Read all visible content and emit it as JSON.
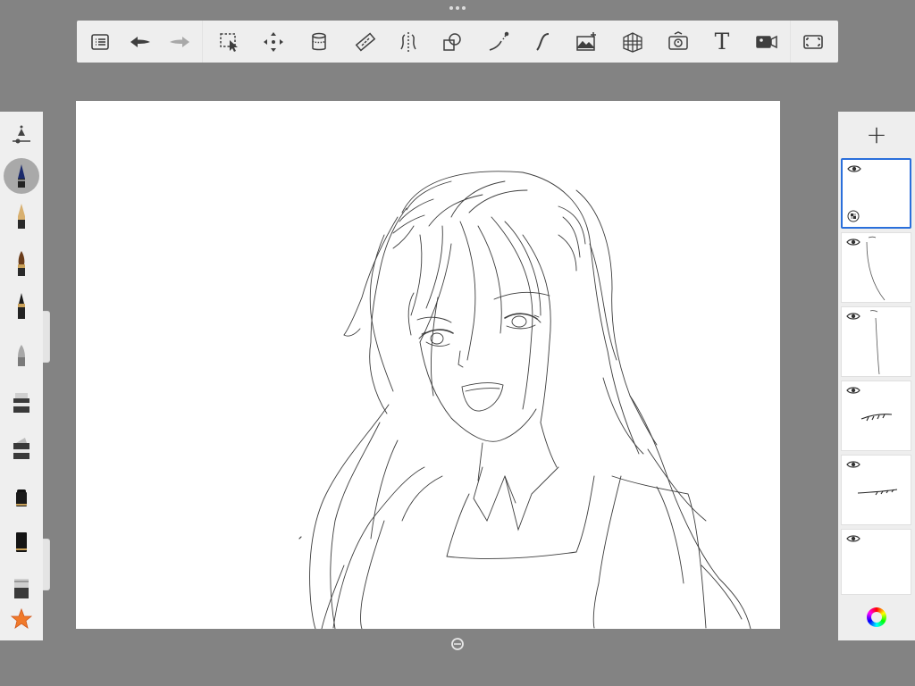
{
  "toolbar": {
    "tools": [
      {
        "name": "list-menu-icon"
      },
      {
        "name": "undo-icon"
      },
      {
        "name": "redo-icon"
      },
      {
        "name": "selection-icon"
      },
      {
        "name": "transform-move-icon"
      },
      {
        "name": "fill-bucket-icon"
      },
      {
        "name": "ruler-icon"
      },
      {
        "name": "symmetry-icon"
      },
      {
        "name": "shapes-icon"
      },
      {
        "name": "stroke-stabilizer-icon"
      },
      {
        "name": "predictive-stroke-icon"
      },
      {
        "name": "add-image-icon"
      },
      {
        "name": "perspective-guide-icon"
      },
      {
        "name": "time-lapse-icon"
      },
      {
        "name": "text-tool-icon",
        "label": "T"
      },
      {
        "name": "video-record-icon"
      },
      {
        "name": "fullscreen-icon"
      }
    ]
  },
  "brushes": [
    {
      "name": "brush-properties-icon"
    },
    {
      "name": "brush-pencil-icon",
      "active": true
    },
    {
      "name": "brush-technical-pen-icon"
    },
    {
      "name": "brush-paintbrush-icon"
    },
    {
      "name": "brush-ink-pen-icon"
    },
    {
      "name": "brush-airbrush-icon"
    },
    {
      "name": "brush-marker-icon"
    },
    {
      "name": "brush-chisel-marker-icon"
    },
    {
      "name": "brush-felt-tip-icon"
    },
    {
      "name": "brush-black-marker-icon"
    },
    {
      "name": "brush-smudge-icon"
    },
    {
      "name": "favorites-star-icon"
    }
  ],
  "layers": {
    "add_label": "+",
    "items": [
      {
        "name": "layer-1",
        "selected": true
      },
      {
        "name": "layer-2",
        "selected": false
      },
      {
        "name": "layer-3",
        "selected": false
      },
      {
        "name": "layer-4",
        "selected": false
      },
      {
        "name": "layer-5",
        "selected": false
      },
      {
        "name": "layer-6",
        "selected": false
      }
    ]
  },
  "colors": {
    "accent": "#2a6fdb",
    "background": "#838383",
    "panel": "#eeeeee"
  }
}
